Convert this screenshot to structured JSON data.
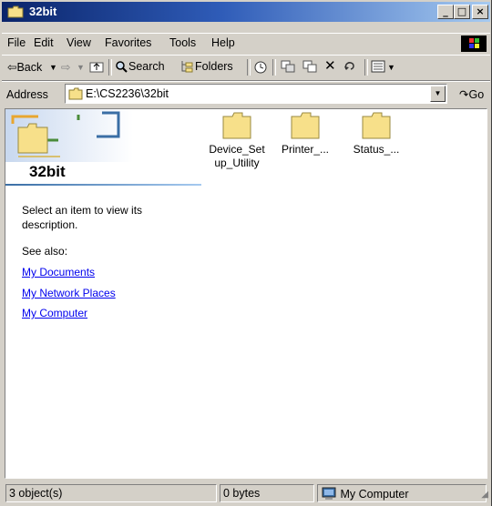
{
  "window": {
    "title": "32bit",
    "buttons": [
      "_",
      "□",
      "×"
    ]
  },
  "menu": [
    {
      "label": "File",
      "key": "F"
    },
    {
      "label": "Edit",
      "key": "E"
    },
    {
      "label": "View",
      "key": "V"
    },
    {
      "label": "Favorites",
      "key": "a"
    },
    {
      "label": "Tools",
      "key": "T"
    },
    {
      "label": "Help",
      "key": "H"
    }
  ],
  "toolbar": {
    "back": "⇦Back",
    "search": "Search",
    "folders": "Folders"
  },
  "address": {
    "label": "Address",
    "value": "E:\\CS2236\\32bit",
    "go": "Go"
  },
  "panel": {
    "title": "32bit",
    "description": "Select an item to view its description.",
    "see_also": "See also:",
    "links": [
      "My Documents",
      "My Network Places",
      "My Computer"
    ]
  },
  "files": [
    {
      "name_line1": "Device_Set",
      "name_line2": "up_Utility"
    },
    {
      "name_line1": "Printer_...",
      "name_line2": ""
    },
    {
      "name_line1": "Status_...",
      "name_line2": ""
    }
  ],
  "status": {
    "objects": "3 object(s)",
    "size": "0 bytes",
    "location": "My Computer"
  },
  "colors": {
    "chrome": "#d4d0c8",
    "titlebar": "#0a246a",
    "link": "#0000ee"
  }
}
